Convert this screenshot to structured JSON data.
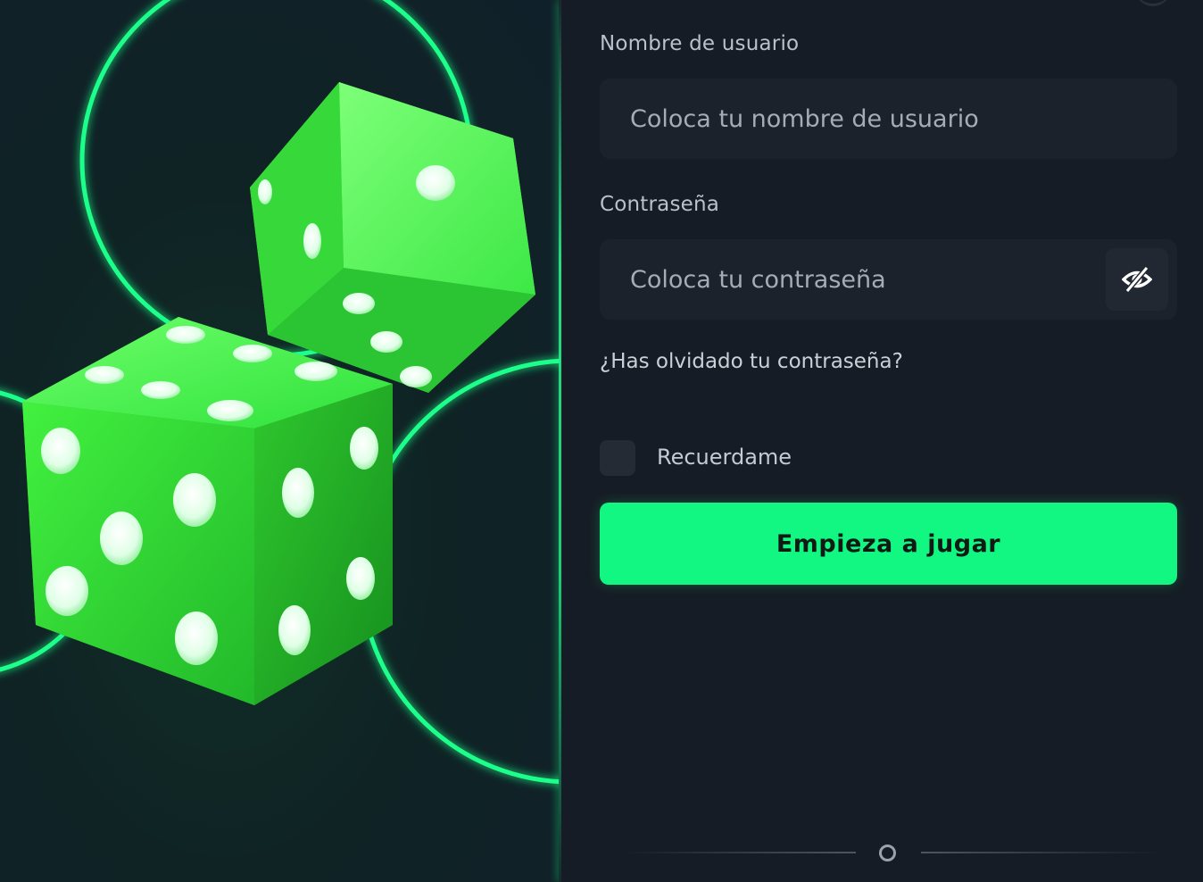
{
  "form": {
    "username_label": "Nombre de usuario",
    "username_placeholder": "Coloca tu nombre de usuario",
    "username_value": "",
    "password_label": "Contraseña",
    "password_placeholder": "Coloca tu contraseña",
    "password_value": "",
    "forgot_link": "¿Has olvidado tu contraseña?",
    "remember_label": "Recuerdame",
    "remember_checked": false,
    "submit_label": "Empieza a jugar"
  },
  "icons": {
    "password_toggle": "eye-slash-icon",
    "divider_dot": "ring-icon"
  },
  "colors": {
    "accent": "#11f782",
    "background": "#161c25",
    "field": "#1c222c",
    "neon_ring": "#1fff8a"
  }
}
